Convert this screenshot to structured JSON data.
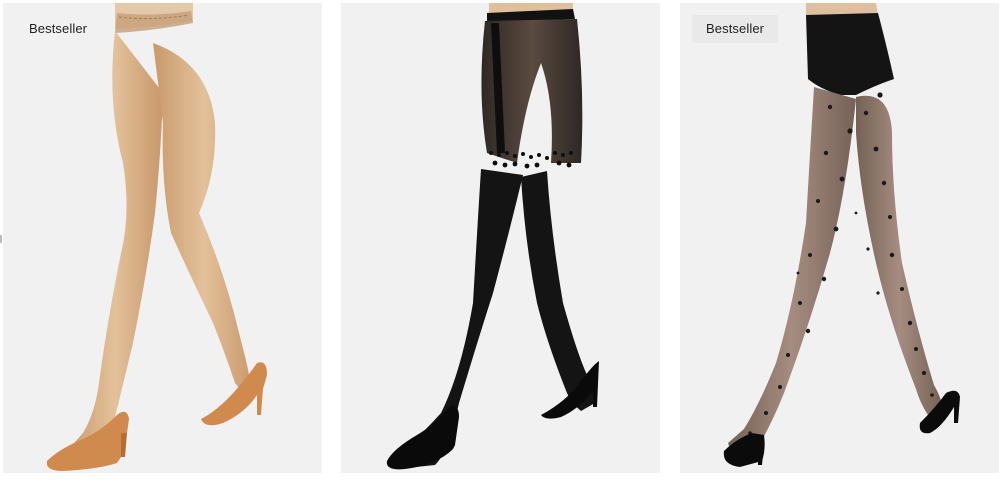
{
  "products": [
    {
      "badge": "Bestseller",
      "image": "nude-lace-top-tights-image",
      "color": "#d8b48c"
    },
    {
      "badge": "",
      "image": "black-over-knee-effect-tights-image",
      "color": "#1b1b1b"
    },
    {
      "badge": "Bestseller",
      "image": "black-polka-dot-tights-image",
      "color": "#2a2a2a"
    }
  ]
}
